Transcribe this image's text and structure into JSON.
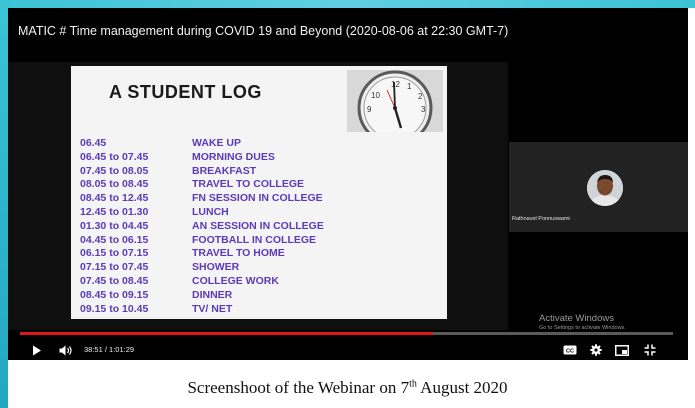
{
  "video": {
    "title": "MATIC # Time management during COVID 19 and Beyond (2020-08-06 at 22:30 GMT-7)"
  },
  "slide": {
    "title": "A STUDENT LOG",
    "clock_numerals": [
      "10",
      "12",
      "1",
      "2",
      "9",
      "3"
    ],
    "log": [
      {
        "time": "06.45",
        "activity": "WAKE UP"
      },
      {
        "time": "06.45 to 07.45",
        "activity": "MORNING DUES"
      },
      {
        "time": "07.45 to 08.05",
        "activity": "BREAKFAST"
      },
      {
        "time": "08.05 to 08.45",
        "activity": "TRAVEL TO COLLEGE"
      },
      {
        "time": "08.45 to 12.45",
        "activity": "FN SESSION IN COLLEGE"
      },
      {
        "time": "12.45 to 01.30",
        "activity": "LUNCH"
      },
      {
        "time": "01.30 to 04.45",
        "activity": "AN SESSION IN COLLEGE"
      },
      {
        "time": "04.45 to 06.15",
        "activity": "FOOTBALL IN COLLEGE"
      },
      {
        "time": "06.15 to 07.15",
        "activity": "TRAVEL TO HOME"
      },
      {
        "time": "07.15 to 07.45",
        "activity": "SHOWER"
      },
      {
        "time": "07.45 to 08.45",
        "activity": "COLLEGE WORK"
      },
      {
        "time": "08.45 to 09.15",
        "activity": "DINNER"
      },
      {
        "time": "09.15 to 10.45",
        "activity": "TV/ NET"
      }
    ]
  },
  "presenter": {
    "name": "Rathnavel Ponnuswami"
  },
  "watermark": {
    "line1": "Activate Windows",
    "line2": "Go to Settings to activate Windows."
  },
  "player": {
    "current_time": "38:51",
    "duration": "1:01:29",
    "time_display": "38:51 / 1:01:29",
    "progress_fraction": 0.632,
    "icons": {
      "play": "play-icon",
      "volume": "volume-icon",
      "captions": "captions-icon",
      "settings": "gear-icon",
      "miniplayer": "miniplayer-icon",
      "fullscreen": "exit-fullscreen-icon"
    },
    "colors": {
      "progress": "#e0141b",
      "track": "#5a5a5a",
      "background": "#000000"
    }
  },
  "caption": {
    "prefix": "Screenshoot  of the Webinar on 7",
    "superscript": "th",
    "suffix": " August  2020"
  },
  "colors": {
    "frame_accent": "#3cc3d6",
    "log_text": "#5b3bb8"
  }
}
